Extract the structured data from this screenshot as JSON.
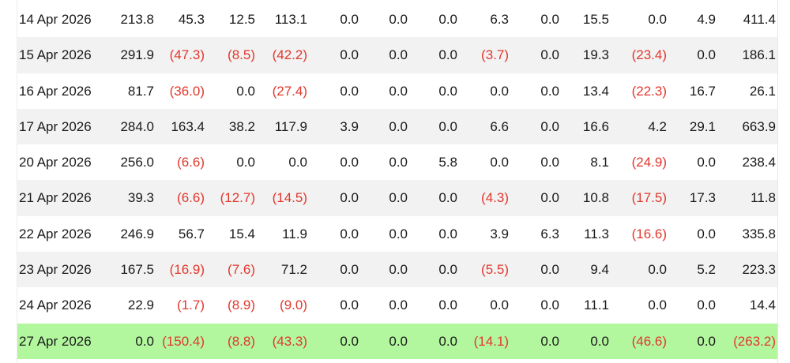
{
  "rows": [
    {
      "date": "14 Apr 2026",
      "values": [
        "213.8",
        "45.3",
        "12.5",
        "113.1",
        "0.0",
        "0.0",
        "0.0",
        "6.3",
        "0.0",
        "15.5",
        "0.0",
        "4.9",
        "411.4"
      ]
    },
    {
      "date": "15 Apr 2026",
      "values": [
        "291.9",
        "(47.3)",
        "(8.5)",
        "(42.2)",
        "0.0",
        "0.0",
        "0.0",
        "(3.7)",
        "0.0",
        "19.3",
        "(23.4)",
        "0.0",
        "186.1"
      ]
    },
    {
      "date": "16 Apr 2026",
      "values": [
        "81.7",
        "(36.0)",
        "0.0",
        "(27.4)",
        "0.0",
        "0.0",
        "0.0",
        "0.0",
        "0.0",
        "13.4",
        "(22.3)",
        "16.7",
        "26.1"
      ]
    },
    {
      "date": "17 Apr 2026",
      "values": [
        "284.0",
        "163.4",
        "38.2",
        "117.9",
        "3.9",
        "0.0",
        "0.0",
        "6.6",
        "0.0",
        "16.6",
        "4.2",
        "29.1",
        "663.9"
      ]
    },
    {
      "date": "20 Apr 2026",
      "values": [
        "256.0",
        "(6.6)",
        "0.0",
        "0.0",
        "0.0",
        "0.0",
        "5.8",
        "0.0",
        "0.0",
        "8.1",
        "(24.9)",
        "0.0",
        "238.4"
      ]
    },
    {
      "date": "21 Apr 2026",
      "values": [
        "39.3",
        "(6.6)",
        "(12.7)",
        "(14.5)",
        "0.0",
        "0.0",
        "0.0",
        "(4.3)",
        "0.0",
        "10.8",
        "(17.5)",
        "17.3",
        "11.8"
      ]
    },
    {
      "date": "22 Apr 2026",
      "values": [
        "246.9",
        "56.7",
        "15.4",
        "11.9",
        "0.0",
        "0.0",
        "0.0",
        "3.9",
        "6.3",
        "11.3",
        "(16.6)",
        "0.0",
        "335.8"
      ]
    },
    {
      "date": "23 Apr 2026",
      "values": [
        "167.5",
        "(16.9)",
        "(7.6)",
        "71.2",
        "0.0",
        "0.0",
        "0.0",
        "(5.5)",
        "0.0",
        "9.4",
        "0.0",
        "5.2",
        "223.3"
      ]
    },
    {
      "date": "24 Apr 2026",
      "values": [
        "22.9",
        "(1.7)",
        "(8.9)",
        "(9.0)",
        "0.0",
        "0.0",
        "0.0",
        "0.0",
        "0.0",
        "11.1",
        "0.0",
        "0.0",
        "14.4"
      ]
    },
    {
      "date": "27 Apr 2026",
      "values": [
        "0.0",
        "(150.4)",
        "(8.8)",
        "(43.3)",
        "0.0",
        "0.0",
        "0.0",
        "(14.1)",
        "0.0",
        "0.0",
        "(46.6)",
        "0.0",
        "(263.2)"
      ]
    }
  ],
  "colors": {
    "negative": "#e2372c",
    "stripe": "#f2f2f2",
    "highlight": "#b2f79e",
    "text": "#1a1a1a"
  },
  "highlighted_row_index": 9
}
